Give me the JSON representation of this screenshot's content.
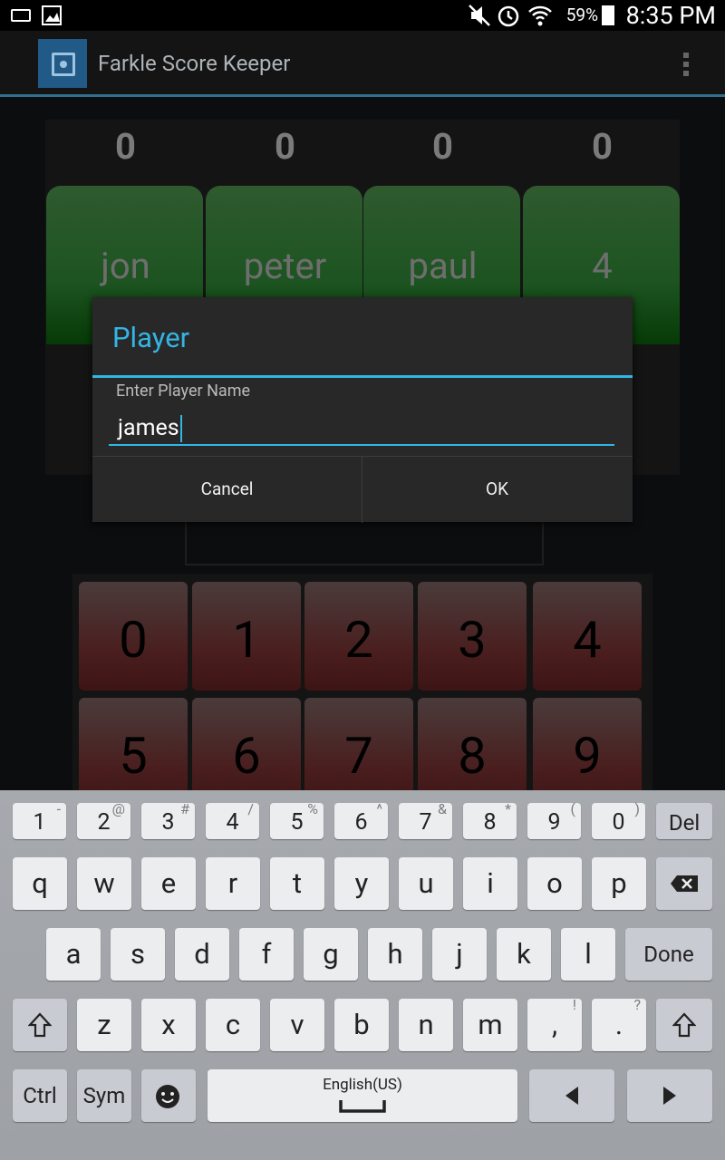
{
  "status": {
    "battery": "59%",
    "time": "8:35 PM"
  },
  "app": {
    "title": "Farkle Score Keeper"
  },
  "scores": [
    "0",
    "0",
    "0",
    "0"
  ],
  "players": [
    "jon",
    "peter",
    "paul",
    "4"
  ],
  "keypad": [
    "0",
    "1",
    "2",
    "3",
    "4",
    "5",
    "6",
    "7",
    "8",
    "9"
  ],
  "dialog": {
    "title": "Player",
    "label": "Enter Player Name",
    "value": "james",
    "cancel": "Cancel",
    "ok": "OK"
  },
  "keyboard": {
    "numbers": [
      [
        "1",
        "-"
      ],
      [
        "2",
        "@"
      ],
      [
        "3",
        "#"
      ],
      [
        "4",
        "/"
      ],
      [
        "5",
        "%"
      ],
      [
        "6",
        "^"
      ],
      [
        "7",
        "&"
      ],
      [
        "8",
        "*"
      ],
      [
        "9",
        "("
      ],
      [
        "0",
        ")"
      ]
    ],
    "del": "Del",
    "row1": [
      "q",
      "w",
      "e",
      "r",
      "t",
      "y",
      "u",
      "i",
      "o",
      "p"
    ],
    "row2": [
      "a",
      "s",
      "d",
      "f",
      "g",
      "h",
      "j",
      "k",
      "l"
    ],
    "done": "Done",
    "row3": [
      "z",
      "x",
      "c",
      "v",
      "b",
      "n",
      "m"
    ],
    "comma": ",",
    "comma_sup": "!",
    "period": ".",
    "period_sup": "?",
    "ctrl": "Ctrl",
    "sym": "Sym",
    "language": "English(US)"
  }
}
